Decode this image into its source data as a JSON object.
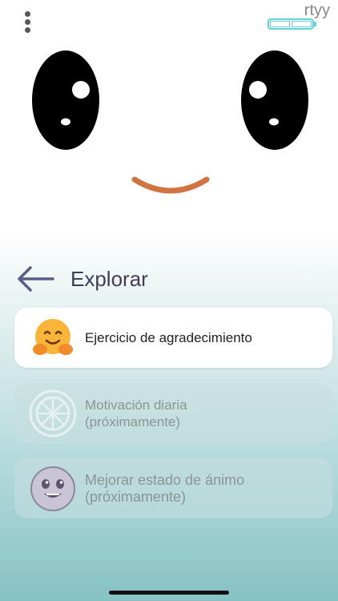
{
  "status": {
    "username": "rtyy"
  },
  "header": {
    "title": "Explorar"
  },
  "cards": [
    {
      "label": "Ejercicio de agradecimiento",
      "icon": "hugging-face-emoji",
      "enabled": true
    },
    {
      "label_line1": "Motivación diaria",
      "label_line2": "(próximamente)",
      "icon": "dharma-wheel-icon",
      "enabled": false
    },
    {
      "label_line1": "Mejorar estado de ánimo",
      "label_line2": "(próximamente)",
      "icon": "smiling-face-icon",
      "enabled": false
    }
  ],
  "colors": {
    "accent": "#62d2d8",
    "mouth": "#d07444",
    "title": "#3f3d5a",
    "eye": "#000000"
  }
}
